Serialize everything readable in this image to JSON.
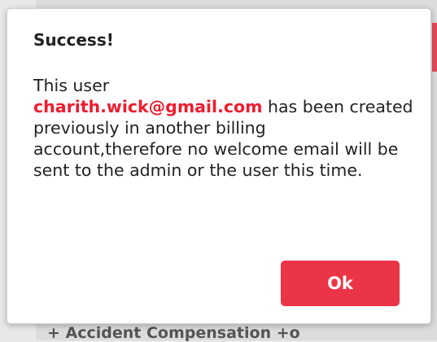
{
  "background": {
    "partial_text": "+ Accident Compensation +o"
  },
  "dialog": {
    "title": "Success!",
    "message_line1": "This user",
    "email": "charith.wick@gmail.com",
    "message_rest": " has been created previously in another billing account,therefore no welcome email will be sent to the admin or the user this time.",
    "ok_label": "Ok"
  },
  "colors": {
    "accent": "#ec3447",
    "email_text": "#ee1c2e"
  }
}
